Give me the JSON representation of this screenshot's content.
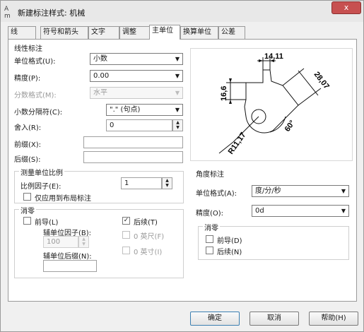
{
  "window": {
    "app_icon_text": "A m",
    "title": "新建标注样式: 机械",
    "close_glyph": "x"
  },
  "tabs": [
    "线",
    "符号和箭头",
    "文字",
    "调整",
    "主单位",
    "换算单位",
    "公差"
  ],
  "linear": {
    "title": "线性标注",
    "unit_format_label": "单位格式(U):",
    "unit_format_value": "小数",
    "precision_label": "精度(P):",
    "precision_value": "0.00",
    "fraction_format_label": "分数格式(M):",
    "fraction_format_value": "水平",
    "decimal_sep_label": "小数分隔符(C):",
    "decimal_sep_value": "\".\" (句点)",
    "round_label": "舍入(R):",
    "round_value": "0",
    "prefix_label": "前缀(X):",
    "prefix_value": "",
    "suffix_label": "后缀(S):",
    "suffix_value": ""
  },
  "scale": {
    "title": "测量单位比例",
    "factor_label": "比例因子(E):",
    "factor_value": "1",
    "layout_only_label": "仅应用到布局标注",
    "layout_only_checked": false
  },
  "zero_linear": {
    "title": "消零",
    "leading_label": "前导(L)",
    "leading_checked": false,
    "trailing_label": "后续(T)",
    "trailing_checked": true,
    "sub_unit_factor_label": "辅单位因子(B):",
    "sub_unit_factor_value": "100",
    "feet_label": "0 英尺(F)",
    "inches_label": "0 英寸(I)",
    "sub_unit_suffix_label": "辅单位后缀(N):",
    "sub_unit_suffix_value": ""
  },
  "angular": {
    "title": "角度标注",
    "unit_format_label": "单位格式(A):",
    "unit_format_value": "度/分/秒",
    "precision_label": "精度(O):",
    "precision_value": "0d",
    "zero_title": "消零",
    "leading_label": "前导(D)",
    "trailing_label": "后续(N)"
  },
  "preview": {
    "dim_top": "14,11",
    "dim_left": "16,6",
    "dim_right": "28,07",
    "dim_angle": "60°",
    "dim_radius": "R11,17"
  },
  "buttons": {
    "ok": "确定",
    "cancel": "取消",
    "help": "帮助(H)"
  },
  "glyphs": {
    "dropdown": "▼",
    "spin_up": "▲",
    "spin_down": "▼",
    "check": "✓"
  }
}
